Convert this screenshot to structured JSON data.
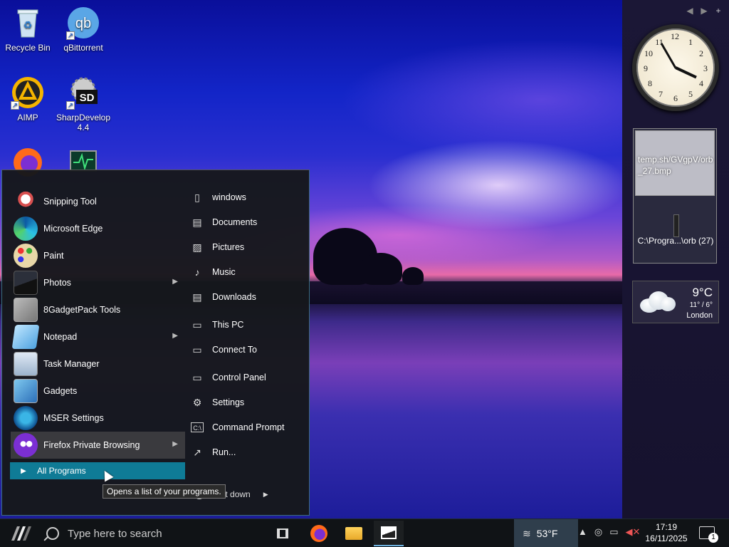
{
  "desktop": {
    "icons": [
      {
        "label": "Recycle Bin",
        "icon": "recycle-bin-icon"
      },
      {
        "label": "qBittorrent",
        "icon": "qbittorrent-icon"
      },
      {
        "label": "AIMP",
        "icon": "aimp-icon"
      },
      {
        "label": "SharpDevelop\n4.4",
        "icon": "sharpdevelop-icon"
      },
      {
        "label": "",
        "icon": "firefox-icon"
      },
      {
        "label": "",
        "icon": "monitor-icon"
      }
    ]
  },
  "sidebar": {
    "nav": {
      "prev": "◀",
      "next": "▶",
      "add": "+"
    },
    "clock": {
      "time": "4:50"
    },
    "feed": {
      "thumb_text": "temp.sh/GVgpV/orb_27.bmp",
      "path": "C:\\Progra...\\orb (27)"
    },
    "weather": {
      "temp": "9°C",
      "range": "11° / 6°",
      "city": "London"
    }
  },
  "start_menu": {
    "programs": [
      {
        "label": "Snipping Tool",
        "icon": "snipping-tool-icon",
        "has_submenu": false
      },
      {
        "label": "Microsoft Edge",
        "icon": "edge-icon",
        "has_submenu": false
      },
      {
        "label": "Paint",
        "icon": "paint-icon",
        "has_submenu": false
      },
      {
        "label": "Photos",
        "icon": "photos-icon",
        "has_submenu": true
      },
      {
        "label": "8GadgetPack Tools",
        "icon": "gadgetpack-icon",
        "has_submenu": false
      },
      {
        "label": "Notepad",
        "icon": "notepad-icon",
        "has_submenu": true
      },
      {
        "label": "Task Manager",
        "icon": "task-manager-icon",
        "has_submenu": false
      },
      {
        "label": "Gadgets",
        "icon": "gadgets-icon",
        "has_submenu": false
      },
      {
        "label": "MSER Settings",
        "icon": "mser-settings-icon",
        "has_submenu": false
      },
      {
        "label": "Firefox Private Browsing",
        "icon": "firefox-private-icon",
        "has_submenu": true
      }
    ],
    "all_programs": "All Programs",
    "places": [
      {
        "label": "windows",
        "icon": "user-folder-icon"
      },
      {
        "label": "Documents",
        "icon": "documents-icon"
      },
      {
        "label": "Pictures",
        "icon": "pictures-icon"
      },
      {
        "label": "Music",
        "icon": "music-icon"
      },
      {
        "label": "Downloads",
        "icon": "downloads-icon"
      },
      {
        "label": "This PC",
        "icon": "this-pc-icon"
      },
      {
        "label": "Connect To",
        "icon": "connect-to-icon"
      },
      {
        "label": "Control Panel",
        "icon": "control-panel-icon"
      },
      {
        "label": "Settings",
        "icon": "settings-gear-icon"
      },
      {
        "label": "Command Prompt",
        "icon": "command-prompt-icon"
      },
      {
        "label": "Run...",
        "icon": "run-icon"
      }
    ],
    "shutdown": "Shut down",
    "tooltip": "Opens a list of your programs."
  },
  "taskbar": {
    "search_placeholder": "Type here to search",
    "weather_temp": "53°F",
    "time": "17:19",
    "date": "16/11/2025",
    "notifications": "1"
  },
  "colors": {
    "start_accent": "#0f7b96",
    "taskbar": "#101316",
    "sidebar": "#1b1736"
  }
}
